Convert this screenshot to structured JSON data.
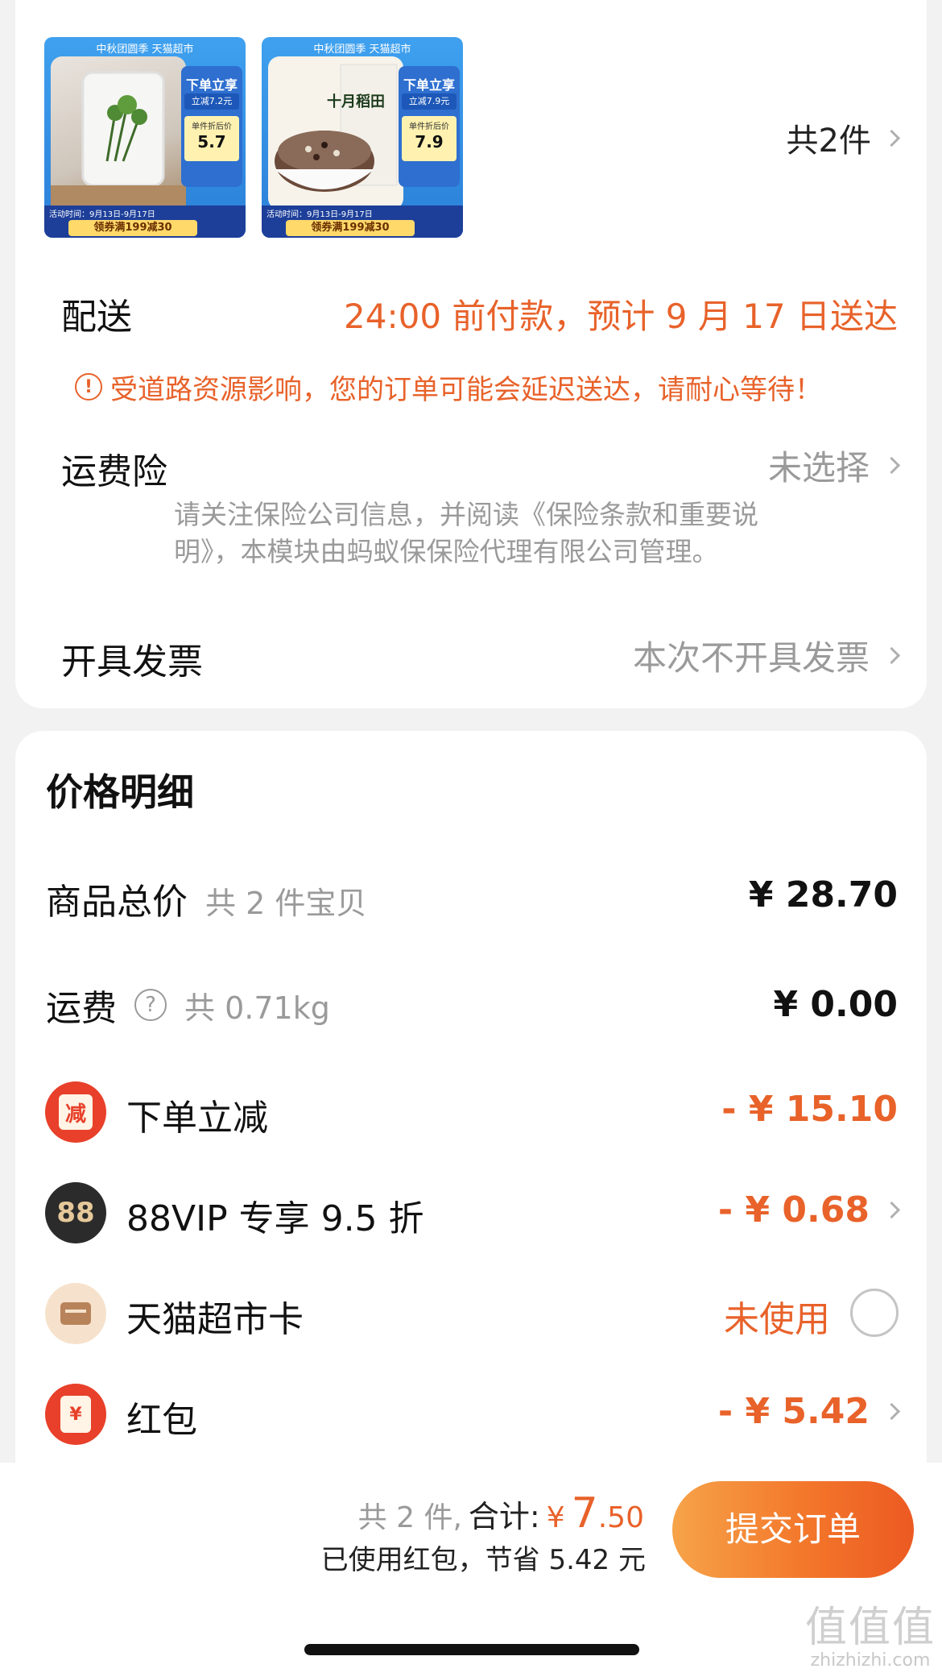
{
  "order_items": {
    "thumbnails": [
      {
        "top_text": "中秋团圆季  天猫超市",
        "badge_title": "下单立享",
        "badge_discount": "立减7.2元",
        "price_label": "单件折后价",
        "price_value": "5.7",
        "footer_time": "活动时间：9月13日-9月17日",
        "footer_coupon": "领券满199减30"
      },
      {
        "top_text": "中秋团圆季  天猫超市",
        "badge_title": "下单立享",
        "badge_discount": "立减7.9元",
        "price_label": "单件折后价",
        "price_value": "7.9",
        "product_name": "十月稻田",
        "footer_time": "活动时间：9月13日-9月17日",
        "footer_coupon": "领券满199减30"
      }
    ],
    "count_text": "共2件"
  },
  "delivery": {
    "label": "配送",
    "value": "24:00 前付款，预计 9 月 17 日送达",
    "notice": "受道路资源影响，您的订单可能会延迟送达，请耐心等待！"
  },
  "shipping_insurance": {
    "label": "运费险",
    "value": "未选择",
    "description_line1": "请关注保险公司信息，并阅读《保险条款和重要说",
    "description_line2": "明》，本模块由蚂蚁保保险代理有限公司管理。"
  },
  "invoice": {
    "label": "开具发票",
    "value": "本次不开具发票"
  },
  "price_details": {
    "title": "价格明细",
    "goods_total_label": "商品总价",
    "goods_total_sub": "共 2 件宝贝",
    "goods_total_value": "¥ 28.70",
    "shipping_label": "运费",
    "shipping_sub": "共 0.71kg",
    "shipping_value": "¥ 0.00",
    "instant_discount_icon": "减",
    "instant_discount_label": "下单立减",
    "instant_discount_value": "- ¥ 15.10",
    "vip_icon": "88",
    "vip_label": "88VIP 专享 9.5 折",
    "vip_value": "- ¥ 0.68",
    "tmall_card_label": "天猫超市卡",
    "tmall_card_value": "未使用",
    "red_packet_icon": "¥",
    "red_packet_label": "红包",
    "red_packet_value": "- ¥ 5.42"
  },
  "summary": {
    "count": "共 2 件,",
    "total_label": "合计:",
    "currency": "¥",
    "total_int": "7",
    "total_dec": ".50",
    "savings": "已使用红包，节省 5.42 元",
    "submit_label": "提交订单"
  },
  "watermark": {
    "big": "值值值",
    "small": "zhizhizhi.com"
  },
  "colors": {
    "accent_orange": "#e8622a",
    "discount_red": "#e8402a",
    "vip_dark": "#2b2b2b"
  }
}
